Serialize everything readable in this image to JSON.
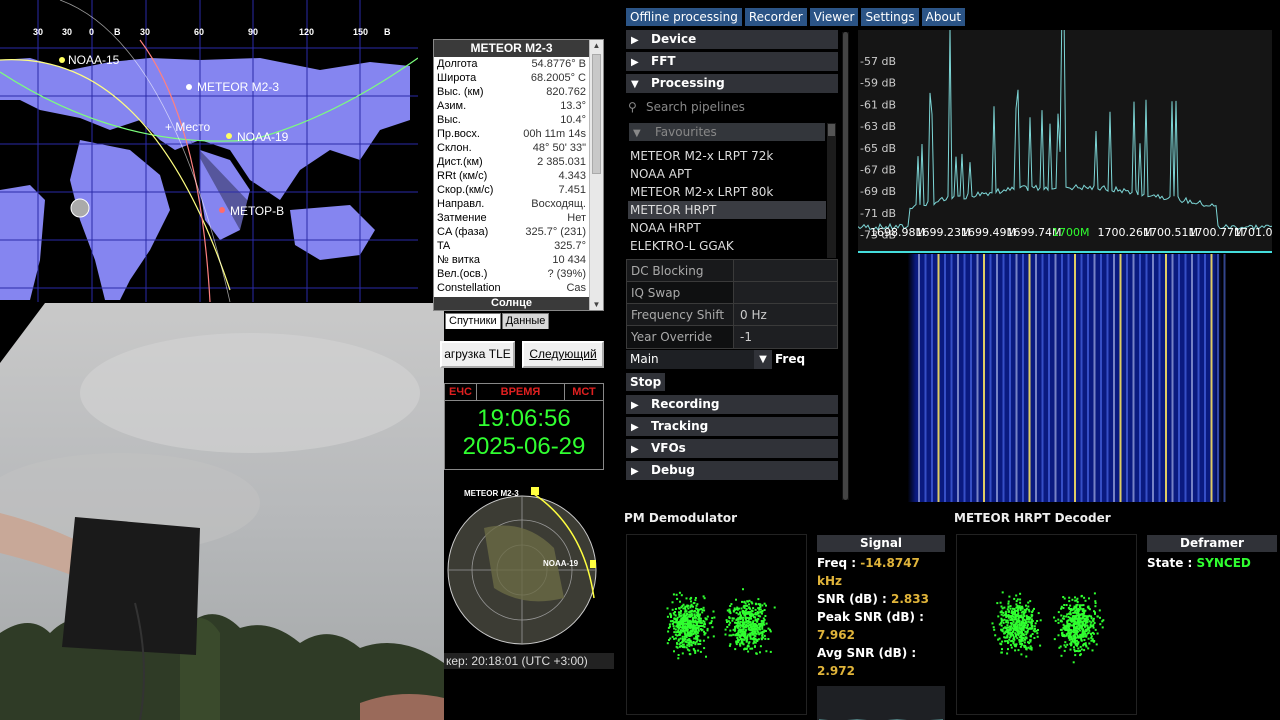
{
  "map": {
    "lon_labels": [
      "30",
      "30",
      "0",
      "B",
      "30",
      "60",
      "90",
      "120",
      "150",
      "B"
    ],
    "satellites": [
      {
        "name": "NOAA-15",
        "color": "#ffff60"
      },
      {
        "name": "METEOR M2-3",
        "color": "#ffffff"
      },
      {
        "name": "+ Место",
        "color": "#ffffff"
      },
      {
        "name": "NOAA-19",
        "color": "#ffffff"
      },
      {
        "name": "МЕТОР-В",
        "color": "#ff6b6b"
      }
    ]
  },
  "satinfo": {
    "title": "METEOR M2-3",
    "rows": [
      {
        "k": "Долгота",
        "v": "54.8776° В"
      },
      {
        "k": "Широта",
        "v": "68.2005° С"
      },
      {
        "k": "Выс. (км)",
        "v": "820.762"
      },
      {
        "k": "Азим.",
        "v": "13.3°"
      },
      {
        "k": "Выс.",
        "v": "10.4°"
      },
      {
        "k": "Пр.восх.",
        "v": "00h 11m 14s"
      },
      {
        "k": "Склон.",
        "v": "48° 50' 33\""
      },
      {
        "k": "Дист.(км)",
        "v": "2 385.031"
      },
      {
        "k": "RRt (км/с)",
        "v": "4.343"
      },
      {
        "k": "Скор.(км/с)",
        "v": "7.451"
      },
      {
        "k": "Направл.",
        "v": "Восходящ."
      },
      {
        "k": "Затмение",
        "v": "Нет"
      },
      {
        "k": "CA (фаза)",
        "v": "325.7° (231)"
      },
      {
        "k": "TA",
        "v": "325.7°"
      },
      {
        "k": "№ витка",
        "v": "10 434"
      },
      {
        "k": "Вел.(осв.)",
        "v": "? (39%)"
      },
      {
        "k": "Constellation",
        "v": "Cas"
      }
    ],
    "footer": "Солнце",
    "tabs": [
      "Спутники",
      "Данные"
    ],
    "btn_tle": "агрузка TLE",
    "btn_next": "Следующий"
  },
  "clock": {
    "headers": [
      "ЕЧС",
      "ВРЕМЯ",
      "МСТ"
    ],
    "time": "19:06:56",
    "date": "2025-06-29"
  },
  "radar": {
    "sat1": "METEOR M2-3",
    "sat2": "NOAA-19"
  },
  "tracker_status": "кер: 20:18:01 (UTC +3:00)",
  "satdump": {
    "menu": [
      "Offline processing",
      "Recorder",
      "Viewer",
      "Settings",
      "About"
    ],
    "sections_top": [
      {
        "label": "Device",
        "arrow": "▶"
      },
      {
        "label": "FFT",
        "arrow": "▶"
      },
      {
        "label": "Processing",
        "arrow": "▼"
      }
    ],
    "search_placeholder": "Search pipelines",
    "favourites": "Favourites",
    "pipelines": [
      "METEOR M2-x LRPT 72k",
      "NOAA APT",
      "METEOR M2-x LRPT 80k",
      "METEOR HRPT",
      "NOAA HRPT",
      "ELEKTRO-L GGAK"
    ],
    "selected_pipeline": 3,
    "options": [
      {
        "k": "DC Blocking",
        "v": ""
      },
      {
        "k": "IQ Swap",
        "v": ""
      },
      {
        "k": "Frequency Shift",
        "v": "0 Hz"
      },
      {
        "k": "Year Override",
        "v": "-1"
      }
    ],
    "main_label": "Main",
    "freq_label": "Freq",
    "stop_label": "Stop",
    "sections_bottom": [
      {
        "label": "Recording",
        "arrow": "▶"
      },
      {
        "label": "Tracking",
        "arrow": "▶"
      },
      {
        "label": "VFOs",
        "arrow": "▶"
      },
      {
        "label": "Debug",
        "arrow": "▶"
      }
    ],
    "spectrum": {
      "db_labels": [
        "-57 dB",
        "-59 dB",
        "-61 dB",
        "-63 dB",
        "-65 dB",
        "-67 dB",
        "-69 dB",
        "-71 dB",
        "-73 dB"
      ],
      "freq_labels": [
        "1698.98M",
        "1699.23M",
        "1699.49M",
        "1699.74M",
        "1700M",
        "1700.26M",
        "1700.51M",
        "1700.77M",
        "1701.02M"
      ]
    },
    "pm_title": "PM Demodulator",
    "decoder_title": "METEOR HRPT Decoder",
    "signal_hdr": "Signal",
    "signal": [
      {
        "k": "Freq :",
        "v": "-14.8747 kHz"
      },
      {
        "k": "SNR (dB) :",
        "v": "2.833"
      },
      {
        "k": "Peak SNR (dB) :",
        "v": "7.962"
      },
      {
        "k": "Avg SNR (dB) :",
        "v": "2.972"
      }
    ],
    "deframer_hdr": "Deframer",
    "state_label": "State :",
    "state_value": "SYNCED"
  },
  "colors": {
    "menu_bg": "#2b5486",
    "section_bg": "#303238",
    "snr_value": "#e0b43a",
    "synced": "#30ff30",
    "constellation": "#30ff30",
    "map_land": "#8585f0"
  }
}
